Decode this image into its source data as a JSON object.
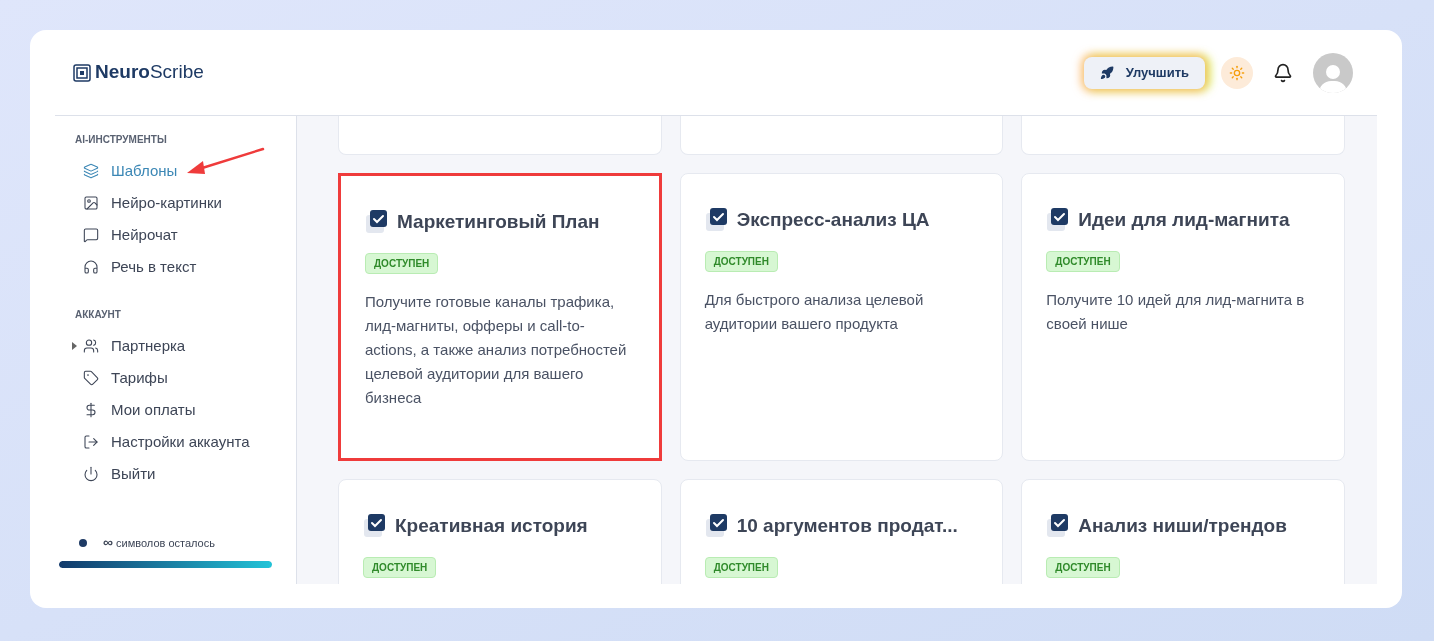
{
  "logo": {
    "bold": "Neuro",
    "light": "Scribe"
  },
  "header": {
    "upgrade_button": "Улучшить"
  },
  "sidebar": {
    "sections": [
      {
        "title": "AI-ИНСТРУМЕНТЫ",
        "items": [
          {
            "label": "Шаблоны",
            "kind": "link",
            "selected": true
          },
          {
            "label": "Нейро-картинки",
            "kind": "link",
            "selected": false
          },
          {
            "label": "Нейрочат",
            "kind": "link",
            "selected": false
          },
          {
            "label": "Речь в текст",
            "kind": "link",
            "selected": false
          }
        ]
      },
      {
        "title": "АККАУНТ",
        "items": [
          {
            "label": "Партнерка",
            "kind": "group",
            "selected": false
          },
          {
            "label": "Тарифы",
            "kind": "link",
            "selected": false
          },
          {
            "label": "Мои оплаты",
            "kind": "link",
            "selected": false
          },
          {
            "label": "Настройки аккаунта",
            "kind": "link",
            "selected": false
          },
          {
            "label": "Выйти",
            "kind": "link",
            "selected": false
          }
        ]
      }
    ],
    "credits": {
      "amount": "∞",
      "label": "символов осталось",
      "level": 1
    }
  },
  "cards": [
    {
      "title": "Маркетинговый План",
      "badge": "ДОСТУПЕН",
      "description": "Получите готовые каналы трафика, лид-магниты, офферы и call-to-actions, а также анализ потребностей целевой аудитории для вашего бизнеса",
      "highlighted": true
    },
    {
      "title": "Экспресс-анализ ЦА",
      "badge": "ДОСТУПЕН",
      "description": "Для быстрого анализа целевой аудитории вашего продукта",
      "highlighted": false
    },
    {
      "title": "Идеи для лид-магнита",
      "badge": "ДОСТУПЕН",
      "description": "Получите 10 идей для лид-магнита в своей нише",
      "highlighted": false
    },
    {
      "title": "Креативная история",
      "badge": "ДОСТУПЕН",
      "highlighted": false
    },
    {
      "title": "10 аргументов продат...",
      "badge": "ДОСТУПЕН",
      "highlighted": false
    },
    {
      "title": "Анализ ниши/трендов",
      "badge": "ДОСТУПЕН",
      "highlighted": false
    }
  ]
}
